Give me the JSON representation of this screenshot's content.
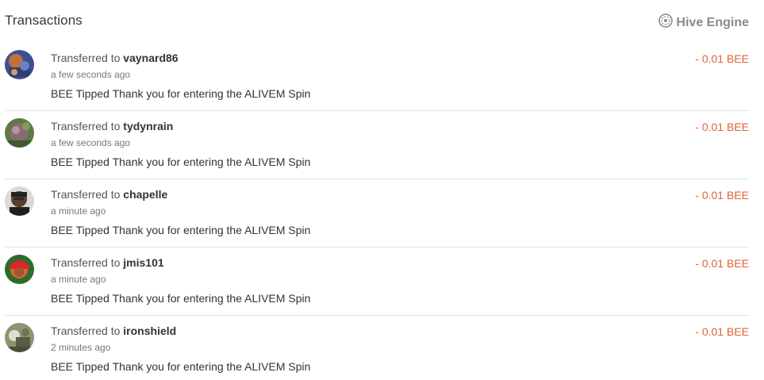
{
  "header": {
    "title": "Transactions",
    "engine_label": "Hive Engine",
    "engine_icon": "hive-engine-icon"
  },
  "colors": {
    "amount": "#e0633a",
    "divider": "#e2e2e2"
  },
  "transactions": [
    {
      "prefix": "Transferred to",
      "user": "vaynard86",
      "time": "a few seconds ago",
      "memo": "BEE Tipped Thank you for entering the ALIVEM Spin",
      "amount": "- 0.01 BEE"
    },
    {
      "prefix": "Transferred to",
      "user": "tydynrain",
      "time": "a few seconds ago",
      "memo": "BEE Tipped Thank you for entering the ALIVEM Spin",
      "amount": "- 0.01 BEE"
    },
    {
      "prefix": "Transferred to",
      "user": "chapelle",
      "time": "a minute ago",
      "memo": "BEE Tipped Thank you for entering the ALIVEM Spin",
      "amount": "- 0.01 BEE"
    },
    {
      "prefix": "Transferred to",
      "user": "jmis101",
      "time": "a minute ago",
      "memo": "BEE Tipped Thank you for entering the ALIVEM Spin",
      "amount": "- 0.01 BEE"
    },
    {
      "prefix": "Transferred to",
      "user": "ironshield",
      "time": "2 minutes ago",
      "memo": "BEE Tipped Thank you for entering the ALIVEM Spin",
      "amount": "- 0.01 BEE"
    }
  ]
}
